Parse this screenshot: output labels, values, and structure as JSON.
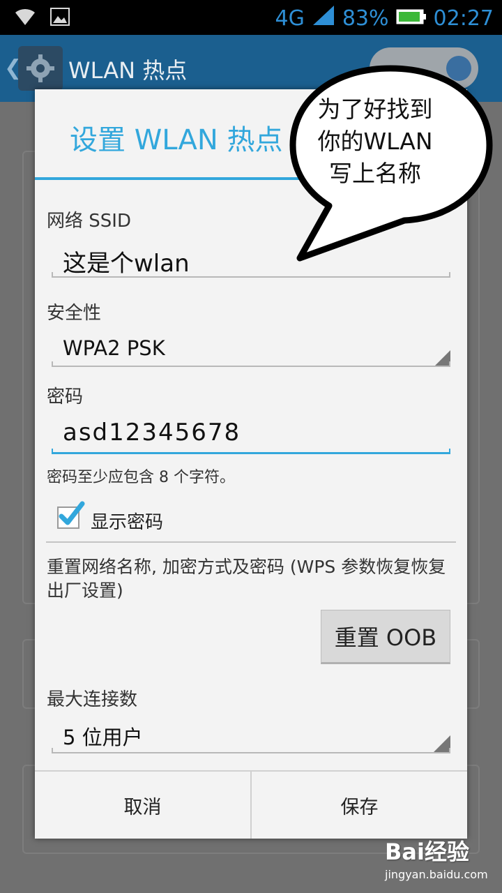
{
  "status_bar": {
    "network": "4G",
    "battery": "83%",
    "time": "02:27"
  },
  "action_bar": {
    "title": "WLAN 热点"
  },
  "dialog": {
    "title": "设置 WLAN 热点",
    "ssid_label": "网络 SSID",
    "ssid_value": "这是个wlan",
    "security_label": "安全性",
    "security_value": "WPA2 PSK",
    "password_label": "密码",
    "password_value": "asd12345678",
    "password_hint": "密码至少应包含 8 个字符。",
    "show_password_label": "显示密码",
    "show_password_checked": true,
    "reset_description": "重置网络名称, 加密方式及密码 (WPS 参数恢复恢复出厂设置)",
    "reset_button": "重置 OOB",
    "max_connections_label": "最大连接数",
    "max_connections_value": "5 位用户",
    "cancel_button": "取消",
    "save_button": "保存"
  },
  "annotation": {
    "lines": [
      "为了好找到",
      "你的WLAN",
      "写上名称"
    ]
  },
  "watermark": {
    "logo": "Bai经验",
    "url": "jingyan.baidu.com"
  },
  "colors": {
    "accent": "#32a7dc",
    "action_bar": "#1b5f8f",
    "status_icon": "#2e8fd6"
  }
}
